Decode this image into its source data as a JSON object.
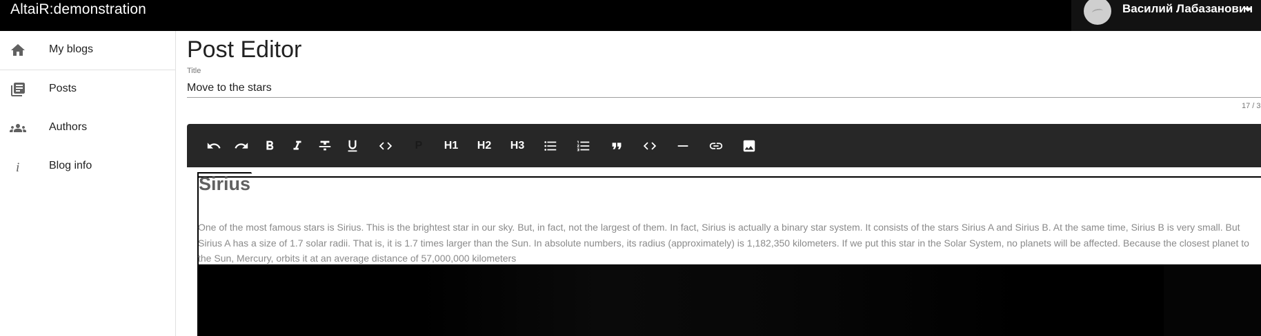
{
  "app": {
    "title": "AltaiR:demonstration"
  },
  "user": {
    "name": "Василий Лабазанович",
    "avatar_icon": "avatar-placeholder"
  },
  "sidebar": {
    "items": [
      {
        "label": "My blogs",
        "icon": "home-icon"
      },
      {
        "label": "Posts",
        "icon": "posts-icon"
      },
      {
        "label": "Authors",
        "icon": "people-icon"
      },
      {
        "label": "Blog info",
        "icon": "info-icon"
      }
    ]
  },
  "main": {
    "heading": "Post Editor",
    "title_field": {
      "label": "Title",
      "value": "Move to the stars",
      "counter": "17 / 3"
    }
  },
  "toolbar": {
    "buttons": [
      {
        "name": "undo",
        "icon": "undo-icon"
      },
      {
        "name": "redo",
        "icon": "redo-icon"
      },
      {
        "name": "bold",
        "icon": "bold-icon"
      },
      {
        "name": "italic",
        "icon": "italic-icon"
      },
      {
        "name": "strikethrough",
        "icon": "strikethrough-icon"
      },
      {
        "name": "underline",
        "icon": "underline-icon"
      },
      {
        "name": "code",
        "icon": "code-icon"
      },
      {
        "name": "paragraph",
        "label": "P"
      },
      {
        "name": "h1",
        "label": "H1"
      },
      {
        "name": "h2",
        "label": "H2"
      },
      {
        "name": "h3",
        "label": "H3"
      },
      {
        "name": "bullet-list",
        "icon": "bullet-list-icon"
      },
      {
        "name": "ordered-list",
        "icon": "ordered-list-icon"
      },
      {
        "name": "blockquote",
        "icon": "quote-icon"
      },
      {
        "name": "code-block",
        "icon": "code-icon"
      },
      {
        "name": "horizontal-rule",
        "icon": "horizontal-rule-icon"
      },
      {
        "name": "link",
        "icon": "link-icon"
      },
      {
        "name": "image",
        "icon": "image-icon"
      }
    ]
  },
  "editor": {
    "heading": "Sirius",
    "paragraph": "One of the most famous stars is Sirius. This is the brightest star in our sky. But, in fact, not the largest of them. In fact, Sirius is actually a binary star system. It consists of the stars Sirius A and Sirius B. At the same time, Sirius B is very small. But Sirius A has a size of 1.7 solar radii. That is, it is 1.7 times larger than the Sun. In absolute numbers, its radius (approximately) is 1,182,350 kilometers. If we put this star in the Solar System, no planets will be affected. Because the closest planet to the Sun, Mercury, orbits it at an average distance of 57,000,000 kilometers"
  }
}
